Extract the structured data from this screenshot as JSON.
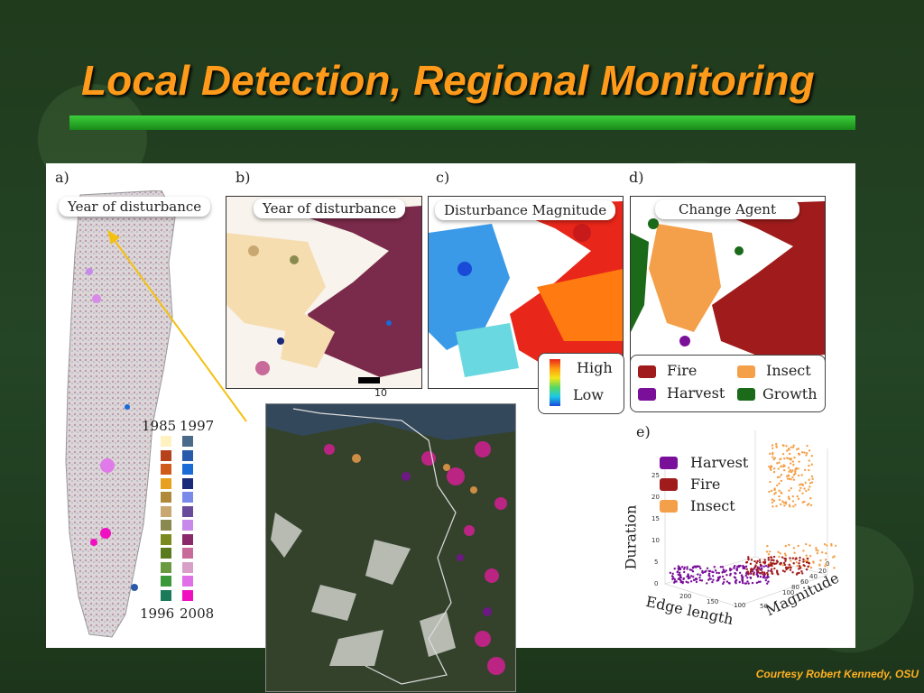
{
  "title": "Local Detection, Regional Monitoring",
  "credit": "Courtesy Robert Kennedy, OSU",
  "panels": {
    "a": {
      "letter": "a)",
      "label": "Year of disturbance"
    },
    "b": {
      "letter": "b)",
      "label": "Year of disturbance",
      "scale": "10"
    },
    "c": {
      "letter": "c)",
      "label": "Disturbance Magnitude",
      "high": "High",
      "low": "Low"
    },
    "d": {
      "letter": "d)",
      "label": "Change Agent",
      "legend": [
        {
          "label": "Fire",
          "color": "#a01c1c"
        },
        {
          "label": "Insect",
          "color": "#f4a04a"
        },
        {
          "label": "Harvest",
          "color": "#7a0f9a"
        },
        {
          "label": "Growth",
          "color": "#1a6a1a"
        }
      ]
    },
    "e": {
      "letter": "e)",
      "legend": [
        {
          "label": "Harvest",
          "color": "#7a0f9a"
        },
        {
          "label": "Fire",
          "color": "#a01c1c"
        },
        {
          "label": "Insect",
          "color": "#f4a04a"
        }
      ],
      "axis_z": "Duration",
      "axis_x": "Edge length",
      "axis_y": "Magnitude",
      "z_ticks": [
        "25",
        "20",
        "15",
        "10",
        "5",
        "0"
      ],
      "x_ticks": [
        "200",
        "150",
        "100",
        "50"
      ],
      "y_ticks": [
        "0",
        "20",
        "40",
        "60",
        "80",
        "100"
      ]
    }
  },
  "years": {
    "start_left": "1985",
    "start_right": "1997",
    "end_left": "1996",
    "end_right": "2008",
    "left_colors": [
      "#fff2c0",
      "#b5421a",
      "#cf5a1a",
      "#e8a020",
      "#b08a3a",
      "#c8a870",
      "#8a8a50",
      "#7a8a20",
      "#5a7a20",
      "#6a9a40",
      "#3a9a3a",
      "#1a7a5a"
    ],
    "right_colors": [
      "#4a6a8a",
      "#2a5aaa",
      "#1a6ad8",
      "#1a2a7a",
      "#7a8aea",
      "#6a4a9a",
      "#c88aea",
      "#8a2a6a",
      "#c86a9a",
      "#d8a0c8",
      "#e070e8",
      "#f010c0"
    ]
  },
  "colors": {
    "accent": "#ff9a1a",
    "bar": "#2aaa2a",
    "fire": "#a01c1c",
    "insect": "#f4a04a",
    "harvest": "#7a0f9a",
    "growth": "#1a6a1a",
    "credit": "#ffb020"
  }
}
